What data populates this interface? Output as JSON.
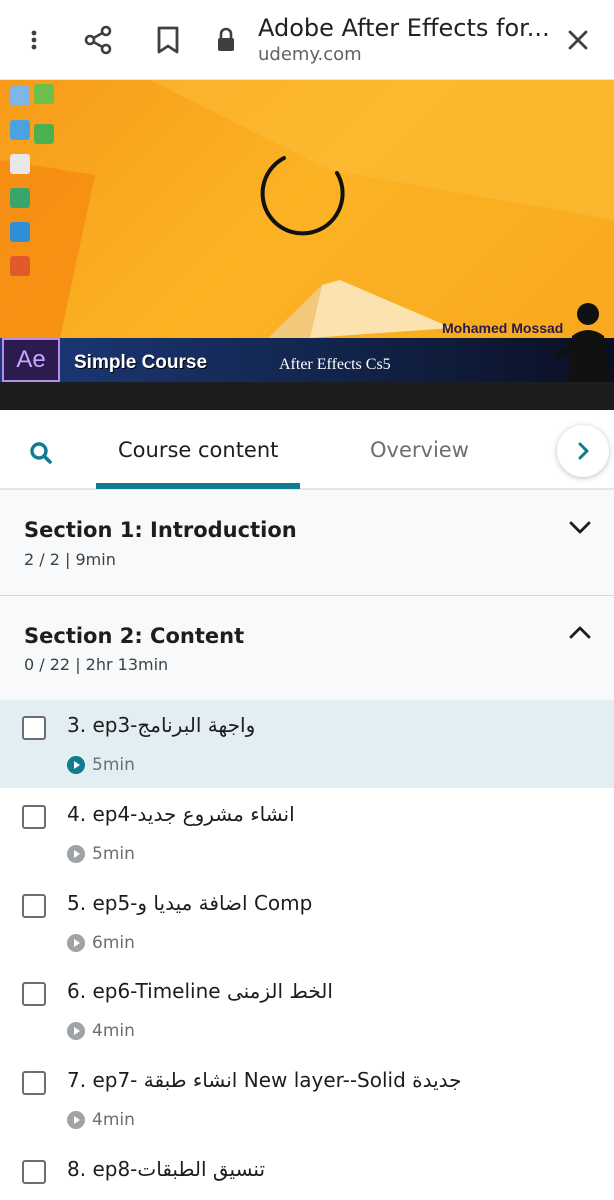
{
  "browser": {
    "title": "Adobe After Effects for...",
    "url": "udemy.com"
  },
  "video": {
    "presenter": "Mohamed Mossad",
    "logo_text": "Ae",
    "banner_title": "Simple Course",
    "banner_subtitle": "After Effects Cs5"
  },
  "tabs": {
    "items": [
      {
        "label": "Course content",
        "active": true
      },
      {
        "label": "Overview",
        "active": false
      }
    ]
  },
  "sections": [
    {
      "title": "Section 1: Introduction",
      "meta": "2 / 2  |  9min",
      "expanded": false
    },
    {
      "title": "Section 2: Content",
      "meta": "0 / 22  |  2hr 13min",
      "expanded": true
    }
  ],
  "lectures": [
    {
      "title": "3. ep3-واجهة البرنامج",
      "duration": "5min",
      "current": true
    },
    {
      "title": "4. ep4-انشاء مشروع جديد",
      "duration": "5min",
      "current": false
    },
    {
      "title": "5. ep5-اضافة ميديا و Comp",
      "duration": "6min",
      "current": false
    },
    {
      "title": "6. ep6-Timeline الخط الزمنى",
      "duration": "4min",
      "current": false
    },
    {
      "title": "7. ep7- انشاء طبقة New layer--Solid جديدة",
      "duration": "4min",
      "current": false
    },
    {
      "title": "8. ep8-تنسيق الطبقات",
      "duration": "",
      "current": false
    }
  ],
  "colors": {
    "accent": "#0f7c90",
    "current_row": "#e3eef2",
    "section_bg": "#f7f9fa"
  },
  "icons": [
    "more-vert-icon",
    "share-icon",
    "bookmark-icon",
    "lock-icon",
    "close-icon",
    "search-icon",
    "chevron-right-icon",
    "chevron-down-icon",
    "chevron-up-icon",
    "play-circle-icon"
  ]
}
